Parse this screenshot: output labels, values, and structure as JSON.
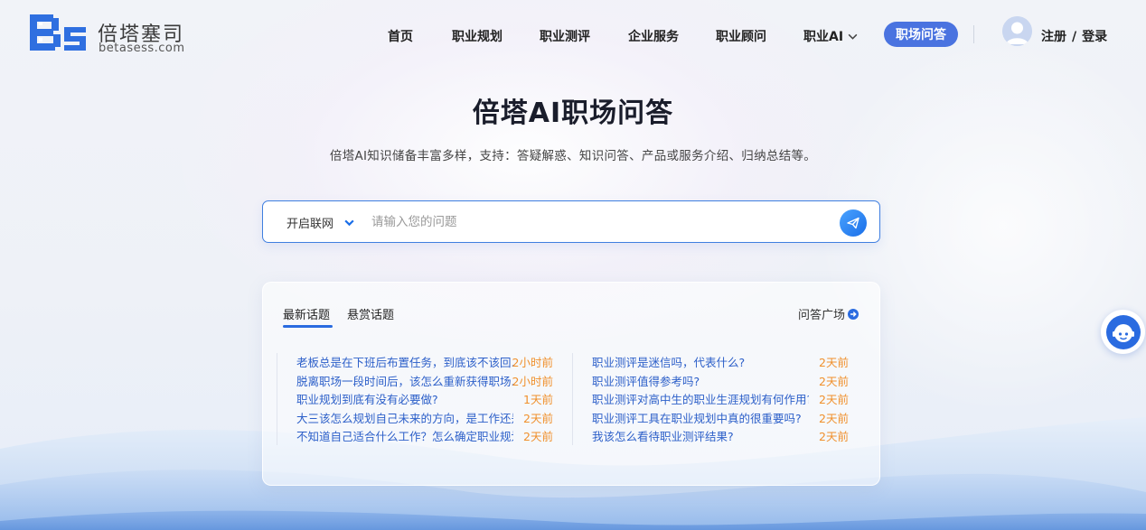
{
  "brand": {
    "name": "倍塔塞司",
    "domain": "betasess.com",
    "logo_mark": "Bs"
  },
  "nav": {
    "items": [
      {
        "label": "首页"
      },
      {
        "label": "职业规划"
      },
      {
        "label": "职业测评"
      },
      {
        "label": "企业服务"
      },
      {
        "label": "职业顾问"
      },
      {
        "label": "职业AI"
      }
    ],
    "active_label": "职场问答",
    "register_label": "注册",
    "separator": "/",
    "login_label": "登录"
  },
  "hero": {
    "title": "倍塔AI职场问答",
    "subtitle": "倍塔AI知识储备丰富多样，支持：答疑解惑、知识问答、产品或服务介绍、归纳总结等。"
  },
  "search": {
    "mode_label": "开启联网",
    "placeholder": "请输入您的问题",
    "value": ""
  },
  "topics": {
    "tabs": [
      "最新话题",
      "悬赏话题"
    ],
    "active_tab": "最新话题",
    "plaza_label": "问答广场",
    "left": [
      {
        "title": "老板总是在下班后布置任务，到底该不该回...",
        "time": "2小时前"
      },
      {
        "title": "脱离职场一段时间后，该怎么重新获得职场...",
        "time": "2小时前"
      },
      {
        "title": "职业规划到底有没有必要做?",
        "time": "1天前"
      },
      {
        "title": "大三该怎么规划自己未来的方向，是工作还是...",
        "time": "2天前"
      },
      {
        "title": "不知道自己适合什么工作？怎么确定职业规划...",
        "time": "2天前"
      }
    ],
    "right": [
      {
        "title": "职业测评是迷信吗，代表什么?",
        "time": "2天前"
      },
      {
        "title": "职业测评值得参考吗?",
        "time": "2天前"
      },
      {
        "title": "职业测评对高中生的职业生涯规划有何作用?",
        "time": "2天前"
      },
      {
        "title": "职业测评工具在职业规划中真的很重要吗?",
        "time": "2天前"
      },
      {
        "title": "我该怎么看待职业测评结果?",
        "time": "2天前"
      }
    ]
  },
  "colors": {
    "accent": "#4a73e0",
    "link": "#2c5fc9",
    "time": "#f0902c",
    "logo_blue": "#2f6fe0"
  },
  "icons": {
    "send": "paper-plane-icon",
    "float": "customer-service-icon",
    "plaza": "arrow-circle-right-icon",
    "chevron": "chevron-down-icon"
  }
}
